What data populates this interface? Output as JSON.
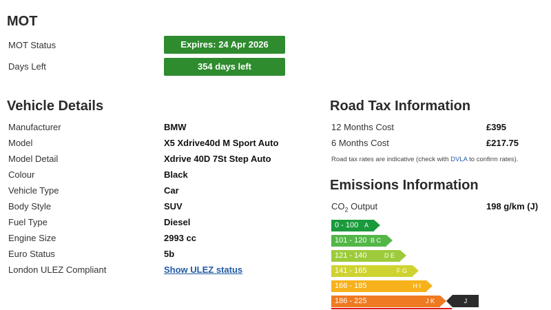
{
  "mot": {
    "title": "MOT",
    "status_label": "MOT Status",
    "status_value": "Expires: 24 Apr 2026",
    "days_label": "Days Left",
    "days_value": "354 days left"
  },
  "vehicle": {
    "title": "Vehicle Details",
    "rows": [
      {
        "label": "Manufacturer",
        "value": "BMW"
      },
      {
        "label": "Model",
        "value": "X5 Xdrive40d M Sport Auto"
      },
      {
        "label": "Model Detail",
        "value": "Xdrive 40D 7St Step Auto"
      },
      {
        "label": "Colour",
        "value": "Black"
      },
      {
        "label": "Vehicle Type",
        "value": "Car"
      },
      {
        "label": "Body Style",
        "value": "SUV"
      },
      {
        "label": "Fuel Type",
        "value": "Diesel"
      },
      {
        "label": "Engine Size",
        "value": "2993 cc"
      },
      {
        "label": "Euro Status",
        "value": "5b"
      }
    ],
    "ulez_label": "London ULEZ Compliant",
    "ulez_link": "Show ULEZ status"
  },
  "tax": {
    "title": "Road Tax Information",
    "rows": [
      {
        "label": "12 Months Cost",
        "value": "£395"
      },
      {
        "label": "6 Months Cost",
        "value": "£217.75"
      }
    ],
    "note_prefix": "Road tax rates are indicative (check with ",
    "note_link": "DVLA",
    "note_suffix": " to confirm rates)."
  },
  "emissions": {
    "title": "Emissions Information",
    "co2_label_main": "CO",
    "co2_label_sub": "2",
    "co2_label_rest": " Output",
    "co2_value": "198 g/km (J)",
    "bands": [
      {
        "range": "0 - 100",
        "letter": "A",
        "color": "#1a9a3c"
      },
      {
        "range": "101 - 120",
        "letter": "B C",
        "color": "#52b747"
      },
      {
        "range": "121 - 140",
        "letter": "D E",
        "color": "#9dcb3b"
      },
      {
        "range": "141 - 165",
        "letter": "F G",
        "color": "#cfd331"
      },
      {
        "range": "166 - 185",
        "letter": "H I",
        "color": "#f7b21b"
      },
      {
        "range": "186 - 225",
        "letter": "J K",
        "color": "#ef7a22"
      }
    ],
    "current_band": "J"
  }
}
